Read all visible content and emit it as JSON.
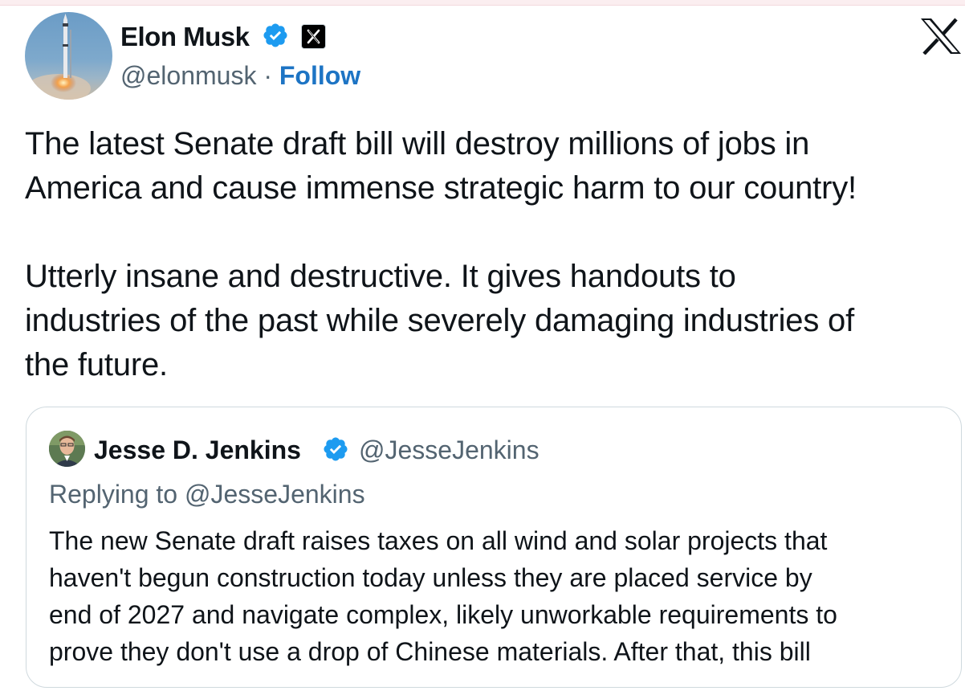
{
  "author": {
    "name": "Elon Musk",
    "handle": "@elonmusk",
    "separator": "·",
    "follow_label": "Follow",
    "verified_icon": "verified-badge-icon",
    "affiliation_icon": "x-affiliation-badge-icon",
    "avatar_icon": "rocket-launch-avatar"
  },
  "platform_icon": "x-logo-icon",
  "tweet": {
    "paragraphs": [
      "The latest Senate draft bill will destroy millions of jobs in\nAmerica and cause immense strategic harm to our country!",
      "Utterly insane and destructive. It gives handouts to\nindustries of the past while severely damaging industries of\nthe future."
    ]
  },
  "quoted_tweet": {
    "name": "Jesse D. Jenkins",
    "handle": "@JesseJenkins",
    "replying_to": "Replying to @JesseJenkins",
    "text": "The new Senate draft raises taxes on all wind and solar projects that\nhaven't begun construction today unless they are placed service by\nend of 2027 and navigate complex, likely unworkable requirements to\nprove they don't use a drop of Chinese materials. After that, this bill"
  },
  "colors": {
    "text": "#0f1419",
    "secondary_text": "#536471",
    "follow_link": "#1d74c4",
    "verified_blue": "#1d9bf0",
    "border": "#cfd9de"
  }
}
